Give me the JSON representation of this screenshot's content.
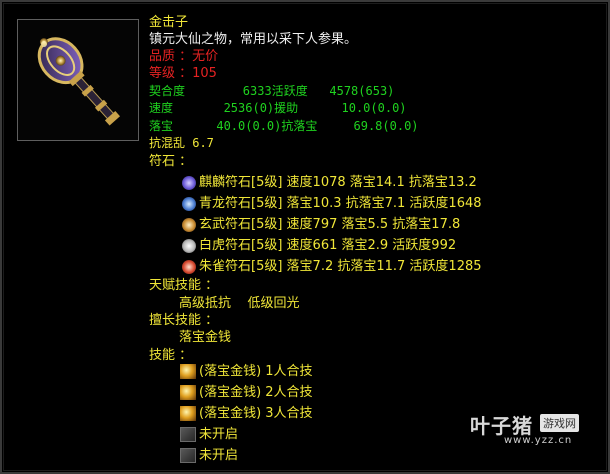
{
  "item": {
    "name": "金击子",
    "description": "镇元大仙之物，常用以采下人参果。",
    "quality": "品质 ：无价",
    "level": "等级 ：105"
  },
  "stats": {
    "row1": "契合度        6333活跃度   4578(653)",
    "row2": "速度       2536(0)援助      10.0(0.0)",
    "row3": "落宝      40.0(0.0)抗落宝     69.8(0.0)",
    "row4": "抗混乱 6.7"
  },
  "runes": {
    "header": "符石 ：",
    "items": [
      {
        "text": "麒麟符石[5级] 速度1078 落宝14.1 抗落宝13.2",
        "icon": "qilin-rune-icon",
        "color": "#7d74e8"
      },
      {
        "text": "青龙符石[5级] 落宝10.3 抗落宝7.1 活跃度1648",
        "icon": "qinglong-rune-icon",
        "color": "#6b98e0"
      },
      {
        "text": "玄武符石[5级] 速度797 落宝5.5 抗落宝17.8",
        "icon": "xuanwu-rune-icon",
        "color": "#d7a048"
      },
      {
        "text": "白虎符石[5级] 速度661 落宝2.9 活跃度992",
        "icon": "baihu-rune-icon",
        "color": "#e8e8e8"
      },
      {
        "text": "朱雀符石[5级] 落宝7.2 抗落宝11.7 活跃度1285",
        "icon": "zhuque-rune-icon",
        "color": "#e06a4c"
      }
    ]
  },
  "talent": {
    "header": "天赋技能 ：",
    "skills": "高级抵抗    低级回光"
  },
  "specialty": {
    "header": "擅长技能 ：",
    "skills": "落宝金钱"
  },
  "skills": {
    "header": "技能 ：",
    "items": [
      {
        "text": "(落宝金钱) 1人合技",
        "icon": "gold-coin-skill-icon"
      },
      {
        "text": "(落宝金钱) 2人合技",
        "icon": "gold-coin-skill-icon"
      },
      {
        "text": "(落宝金钱) 3人合技",
        "icon": "gold-coin-skill-icon"
      },
      {
        "text": "未开启",
        "icon": "locked-skill-icon"
      },
      {
        "text": "未开启",
        "icon": "locked-skill-icon"
      }
    ]
  },
  "watermark": {
    "brand": "叶子猪",
    "tag": "游戏网",
    "url": "www.yzz.cn"
  }
}
